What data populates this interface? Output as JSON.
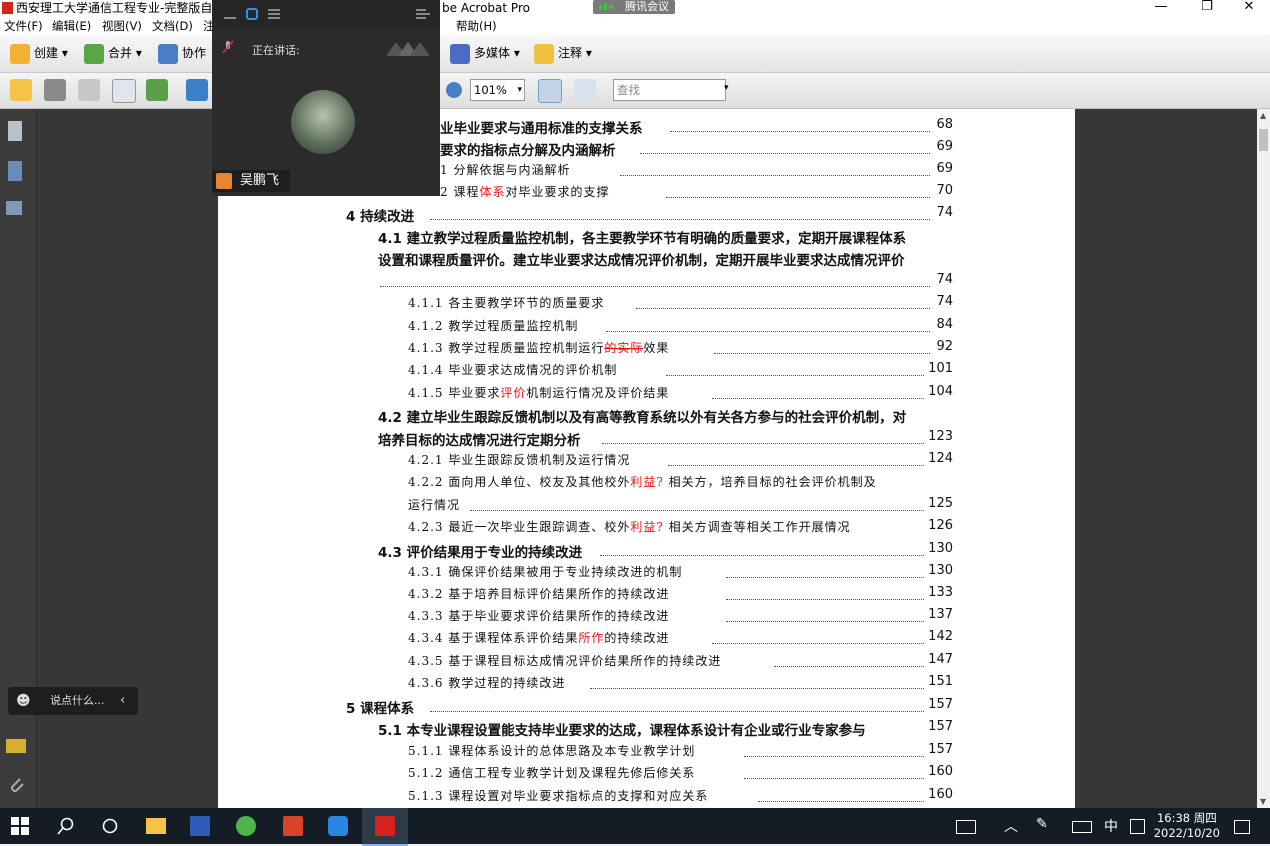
{
  "window": {
    "title_left": "西安理工大学通信工程专业-完整版自评报",
    "title_right": "be Acrobat Pro",
    "min": "—",
    "max": "❐",
    "close": "✕"
  },
  "meeting_tag": "腾讯会议",
  "menu": [
    "文件(F)",
    "编辑(E)",
    "视图(V)",
    "文档(D)",
    "注",
    "帮助(H)"
  ],
  "toolbar1": {
    "create": "创建",
    "merge": "合并",
    "collab": "协作",
    "multimedia": "多媒体",
    "comment": "注释"
  },
  "toolbar2": {
    "zoom": "101%",
    "find_placeholder": "查找"
  },
  "meeting": {
    "speaking_label": "正在讲话:",
    "speaker_name": "吴鹏飞"
  },
  "chat": {
    "placeholder": "说点什么..."
  },
  "toc": [
    {
      "text": "业毕业要求与通用标准的支撑关系",
      "page": "68"
    },
    {
      "text": "要求的指标点分解及内涵解析",
      "page": "69"
    },
    {
      "text": "1  分解依据与内涵解析",
      "page": "69"
    },
    {
      "text_a": "2  课程",
      "text_red": "体系",
      "text_b": "对毕业要求的支撑",
      "page": "70"
    },
    {
      "text": "4  持续改进",
      "page": "74"
    },
    {
      "line1": "4.1  建立教学过程质量监控机制，各主要教学环节有明确的质量要求，定期开展课程体系",
      "line2": "设置和课程质量评价。建立毕业要求达成情况评价机制，定期开展毕业要求达成情况评价",
      "page": "74"
    },
    {
      "text": "4.1.1  各主要教学环节的质量要求",
      "page": "74"
    },
    {
      "text": "4.1.2  教学过程质量监控机制",
      "page": "84"
    },
    {
      "text_a": "4.1.3  教学过程质量监控机制运行",
      "text_red": "的实际",
      "text_b": "效果",
      "page": "92"
    },
    {
      "text": "4.1.4  毕业要求达成情况的评价机制",
      "page": "101"
    },
    {
      "text_a": "4.1.5  毕业要求",
      "text_red": "评价",
      "text_b": "机制运行情况及评价结果",
      "page": "104"
    },
    {
      "line1": "4.2  建立毕业生跟踪反馈机制以及有高等教育系统以外有关各方参与的社会评价机制，对",
      "line2": "培养目标的达成情况进行定期分析",
      "page": "123"
    },
    {
      "text": "4.2.1  毕业生跟踪反馈机制及运行情况",
      "page": "124"
    },
    {
      "line1_a": "4.2.2  面向用人单位、校友及其他校外",
      "line1_red": "利益?",
      "line1_b": "相关方，培养目标的社会评价机制及",
      "line2": "运行情况",
      "page": "125"
    },
    {
      "text_a": "4.2.3  最近一次毕业生跟踪调查、校外",
      "text_red": "利益?",
      "text_b": "相关方调查等相关工作开展情况",
      "page": "126"
    },
    {
      "text": "4.3  评价结果用于专业的持续改进",
      "page": "130"
    },
    {
      "text": "4.3.1  确保评价结果被用于专业持续改进的机制",
      "page": "130"
    },
    {
      "text": "4.3.2  基于培养目标评价结果所作的持续改进",
      "page": "133"
    },
    {
      "text": "4.3.3  基于毕业要求评价结果所作的持续改进",
      "page": "137"
    },
    {
      "text_a": "4.3.4  基于课程体系评价结果",
      "text_red": "所作",
      "text_b": "的持续改进",
      "page": "142"
    },
    {
      "text": "4.3.5  基于课程目标达成情况评价结果所作的持续改进",
      "page": "147"
    },
    {
      "text": "4.3.6  教学过程的持续改进",
      "page": "151"
    },
    {
      "text": "5  课程体系",
      "page": "157"
    },
    {
      "text": "5.1  本专业课程设置能支持毕业要求的达成，课程体系设计有企业或行业专家参与",
      "page": "157"
    },
    {
      "text": "5.1.1  课程体系设计的总体思路及本专业教学计划",
      "page": "157"
    },
    {
      "text": "5.1.2  通信工程专业教学计划及课程先修后修关系",
      "page": "160"
    },
    {
      "text": "5.1.3  课程设置对毕业要求指标点的支撑和对应关系",
      "page": "160"
    }
  ],
  "taskbar": {
    "time": "16:38 周四",
    "date": "2022/10/20",
    "ime": "中"
  }
}
